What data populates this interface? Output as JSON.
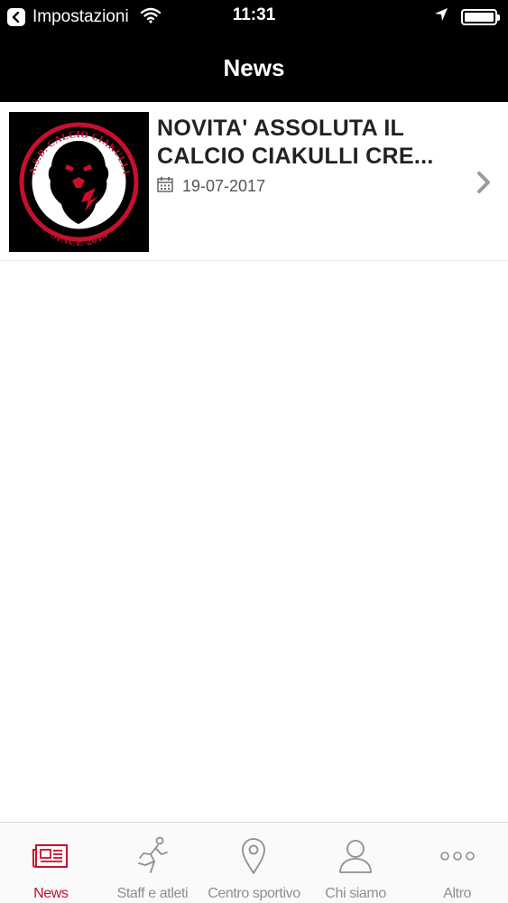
{
  "status_bar": {
    "back_app": "Impostazioni",
    "time": "11:31",
    "battery_level": 1.0
  },
  "nav": {
    "title": "News"
  },
  "news": [
    {
      "title": "NOVITA' ASSOLUTA IL CALCIO CIAKULLI CRE...",
      "date": "19-07-2017",
      "thumbnail": {
        "logo_text_top": "A.S.D. CALCIO CIAKULLI",
        "logo_text_bottom": "SINCE 2014"
      }
    }
  ],
  "tabs": [
    {
      "label": "News",
      "icon": "newspaper-icon",
      "active": true
    },
    {
      "label": "Staff e atleti",
      "icon": "runner-icon",
      "active": false
    },
    {
      "label": "Centro sportivo",
      "icon": "location-pin-icon",
      "active": false
    },
    {
      "label": "Chi siamo",
      "icon": "person-icon",
      "active": false
    },
    {
      "label": "Altro",
      "icon": "more-dots-icon",
      "active": false
    }
  ],
  "colors": {
    "accent": "#c8102e",
    "inactive": "#8e8e93",
    "bar_background": "#000000"
  }
}
